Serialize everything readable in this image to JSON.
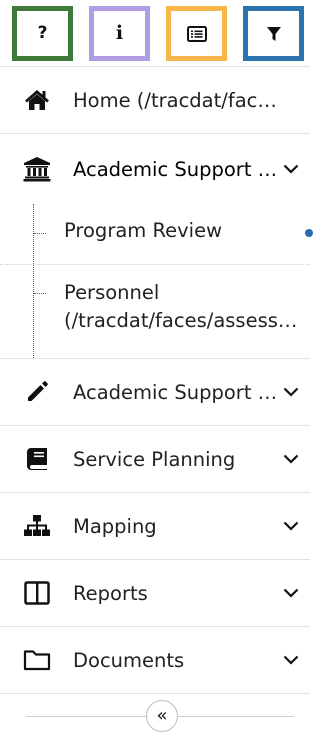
{
  "toolbar": {
    "help_glyph": "?",
    "info_glyph": "i",
    "colors": {
      "help": "#3f7a3a",
      "info": "#b19ce6",
      "list": "#f6b64a",
      "filter": "#2c72ac"
    }
  },
  "nav": {
    "home": "Home (/tracdat/faces/home.xhtml)",
    "academic_support_1": "Academic Support Units",
    "sub_items": {
      "program_review": "Program Review",
      "personnel_line1": "Personnel",
      "personnel_line2": "(/tracdat/faces/assessment.xhtml)"
    },
    "academic_support_2": "Academic Support Units",
    "service_planning": "Service Planning",
    "mapping": "Mapping",
    "reports": "Reports",
    "documents": "Documents"
  },
  "collapse": {
    "glyph": "«"
  }
}
